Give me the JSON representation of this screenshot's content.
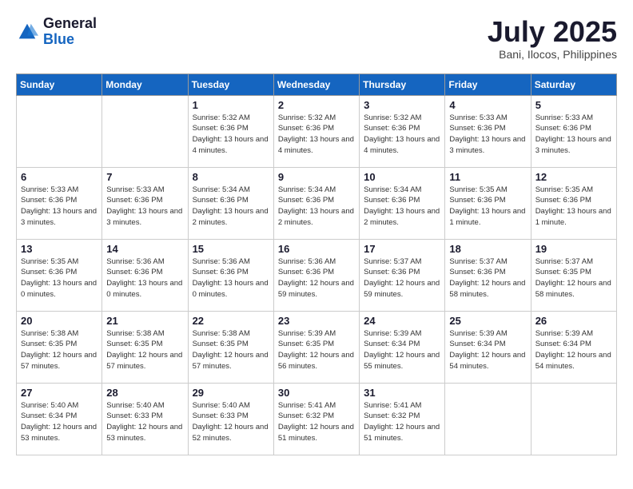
{
  "header": {
    "logo_general": "General",
    "logo_blue": "Blue",
    "month_year": "July 2025",
    "location": "Bani, Ilocos, Philippines"
  },
  "days_of_week": [
    "Sunday",
    "Monday",
    "Tuesday",
    "Wednesday",
    "Thursday",
    "Friday",
    "Saturday"
  ],
  "weeks": [
    [
      {
        "day": "",
        "info": ""
      },
      {
        "day": "",
        "info": ""
      },
      {
        "day": "1",
        "info": "Sunrise: 5:32 AM\nSunset: 6:36 PM\nDaylight: 13 hours and 4 minutes."
      },
      {
        "day": "2",
        "info": "Sunrise: 5:32 AM\nSunset: 6:36 PM\nDaylight: 13 hours and 4 minutes."
      },
      {
        "day": "3",
        "info": "Sunrise: 5:32 AM\nSunset: 6:36 PM\nDaylight: 13 hours and 4 minutes."
      },
      {
        "day": "4",
        "info": "Sunrise: 5:33 AM\nSunset: 6:36 PM\nDaylight: 13 hours and 3 minutes."
      },
      {
        "day": "5",
        "info": "Sunrise: 5:33 AM\nSunset: 6:36 PM\nDaylight: 13 hours and 3 minutes."
      }
    ],
    [
      {
        "day": "6",
        "info": "Sunrise: 5:33 AM\nSunset: 6:36 PM\nDaylight: 13 hours and 3 minutes."
      },
      {
        "day": "7",
        "info": "Sunrise: 5:33 AM\nSunset: 6:36 PM\nDaylight: 13 hours and 3 minutes."
      },
      {
        "day": "8",
        "info": "Sunrise: 5:34 AM\nSunset: 6:36 PM\nDaylight: 13 hours and 2 minutes."
      },
      {
        "day": "9",
        "info": "Sunrise: 5:34 AM\nSunset: 6:36 PM\nDaylight: 13 hours and 2 minutes."
      },
      {
        "day": "10",
        "info": "Sunrise: 5:34 AM\nSunset: 6:36 PM\nDaylight: 13 hours and 2 minutes."
      },
      {
        "day": "11",
        "info": "Sunrise: 5:35 AM\nSunset: 6:36 PM\nDaylight: 13 hours and 1 minute."
      },
      {
        "day": "12",
        "info": "Sunrise: 5:35 AM\nSunset: 6:36 PM\nDaylight: 13 hours and 1 minute."
      }
    ],
    [
      {
        "day": "13",
        "info": "Sunrise: 5:35 AM\nSunset: 6:36 PM\nDaylight: 13 hours and 0 minutes."
      },
      {
        "day": "14",
        "info": "Sunrise: 5:36 AM\nSunset: 6:36 PM\nDaylight: 13 hours and 0 minutes."
      },
      {
        "day": "15",
        "info": "Sunrise: 5:36 AM\nSunset: 6:36 PM\nDaylight: 13 hours and 0 minutes."
      },
      {
        "day": "16",
        "info": "Sunrise: 5:36 AM\nSunset: 6:36 PM\nDaylight: 12 hours and 59 minutes."
      },
      {
        "day": "17",
        "info": "Sunrise: 5:37 AM\nSunset: 6:36 PM\nDaylight: 12 hours and 59 minutes."
      },
      {
        "day": "18",
        "info": "Sunrise: 5:37 AM\nSunset: 6:36 PM\nDaylight: 12 hours and 58 minutes."
      },
      {
        "day": "19",
        "info": "Sunrise: 5:37 AM\nSunset: 6:35 PM\nDaylight: 12 hours and 58 minutes."
      }
    ],
    [
      {
        "day": "20",
        "info": "Sunrise: 5:38 AM\nSunset: 6:35 PM\nDaylight: 12 hours and 57 minutes."
      },
      {
        "day": "21",
        "info": "Sunrise: 5:38 AM\nSunset: 6:35 PM\nDaylight: 12 hours and 57 minutes."
      },
      {
        "day": "22",
        "info": "Sunrise: 5:38 AM\nSunset: 6:35 PM\nDaylight: 12 hours and 57 minutes."
      },
      {
        "day": "23",
        "info": "Sunrise: 5:39 AM\nSunset: 6:35 PM\nDaylight: 12 hours and 56 minutes."
      },
      {
        "day": "24",
        "info": "Sunrise: 5:39 AM\nSunset: 6:34 PM\nDaylight: 12 hours and 55 minutes."
      },
      {
        "day": "25",
        "info": "Sunrise: 5:39 AM\nSunset: 6:34 PM\nDaylight: 12 hours and 54 minutes."
      },
      {
        "day": "26",
        "info": "Sunrise: 5:39 AM\nSunset: 6:34 PM\nDaylight: 12 hours and 54 minutes."
      }
    ],
    [
      {
        "day": "27",
        "info": "Sunrise: 5:40 AM\nSunset: 6:34 PM\nDaylight: 12 hours and 53 minutes."
      },
      {
        "day": "28",
        "info": "Sunrise: 5:40 AM\nSunset: 6:33 PM\nDaylight: 12 hours and 53 minutes."
      },
      {
        "day": "29",
        "info": "Sunrise: 5:40 AM\nSunset: 6:33 PM\nDaylight: 12 hours and 52 minutes."
      },
      {
        "day": "30",
        "info": "Sunrise: 5:41 AM\nSunset: 6:32 PM\nDaylight: 12 hours and 51 minutes."
      },
      {
        "day": "31",
        "info": "Sunrise: 5:41 AM\nSunset: 6:32 PM\nDaylight: 12 hours and 51 minutes."
      },
      {
        "day": "",
        "info": ""
      },
      {
        "day": "",
        "info": ""
      }
    ]
  ]
}
